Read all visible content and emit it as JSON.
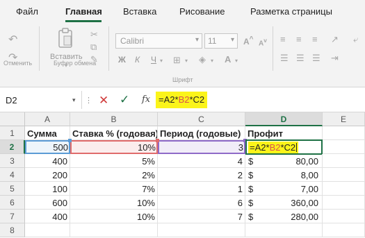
{
  "tabs": [
    "Файл",
    "Главная",
    "Вставка",
    "Рисование",
    "Разметка страницы"
  ],
  "ribbon": {
    "undo_group_label": "Отменить",
    "paste_label": "Вставить",
    "clipboard_group_label": "Буфер обмена",
    "font_name": "Calibri",
    "font_size": "11",
    "font_group_label": "Шрифт",
    "bold": "Ж",
    "italic": "К",
    "underline": "Ч"
  },
  "formula_bar": {
    "name_box": "D2",
    "fx": "fx",
    "formula_parts": [
      {
        "text": "=A2*",
        "color": "#222222"
      },
      {
        "text": "B2",
        "color": "#d9534f"
      },
      {
        "text": "*C2",
        "color": "#222222"
      }
    ]
  },
  "grid": {
    "columns": [
      "A",
      "B",
      "C",
      "D",
      "E"
    ],
    "rows": [
      "1",
      "2",
      "3",
      "4",
      "5",
      "6",
      "7",
      "8"
    ],
    "headers": [
      "Сумма",
      "Ставка % (годовая)",
      "Период (годовые)",
      "Профит"
    ],
    "data": [
      {
        "a": "500",
        "b": "10%",
        "c": "3"
      },
      {
        "a": "400",
        "b": "5%",
        "c": "4",
        "cur": "$",
        "d": "80,00"
      },
      {
        "a": "200",
        "b": "2%",
        "c": "2",
        "cur": "$",
        "d": "8,00"
      },
      {
        "a": "100",
        "b": "7%",
        "c": "1",
        "cur": "$",
        "d": "7,00"
      },
      {
        "a": "600",
        "b": "10%",
        "c": "6",
        "cur": "$",
        "d": "360,00"
      },
      {
        "a": "400",
        "b": "10%",
        "c": "7",
        "cur": "$",
        "d": "280,00"
      }
    ],
    "active_cell_edit": [
      {
        "text": "=A2*",
        "color": "#222222"
      },
      {
        "text": "B2",
        "color": "#d9534f"
      },
      {
        "text": "*C2",
        "color": "#222222"
      }
    ]
  },
  "colors": {
    "accent": "#1e7145",
    "highlight": "#fbf41a",
    "ref_a": "#5b9bd5",
    "ref_b": "#e06b6b",
    "ref_c": "#8e6ac8"
  }
}
